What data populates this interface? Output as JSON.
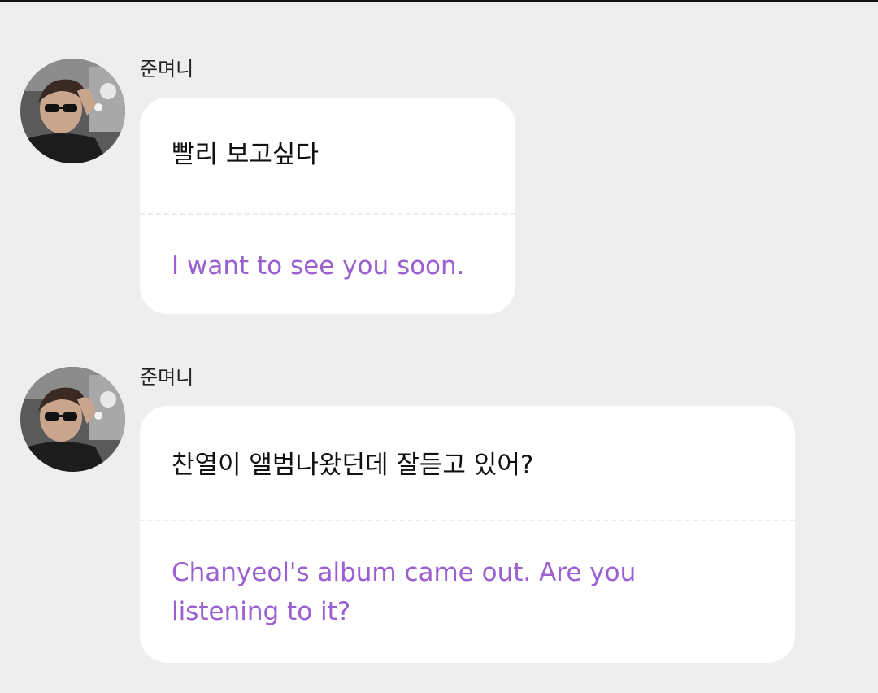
{
  "colors": {
    "background": "#eeeeee",
    "bubble": "#ffffff",
    "translation_text": "#9a5fd0",
    "original_text": "#111111"
  },
  "messages": [
    {
      "sender": "준며니",
      "avatar_icon": "profile-photo",
      "original": "빨리 보고싶다",
      "translation": "I want to see you soon."
    },
    {
      "sender": "준며니",
      "avatar_icon": "profile-photo",
      "original": "찬열이 앨범나왔던데 잘듣고 있어?",
      "translation": "Chanyeol's album came out. Are you listening to it?"
    }
  ]
}
